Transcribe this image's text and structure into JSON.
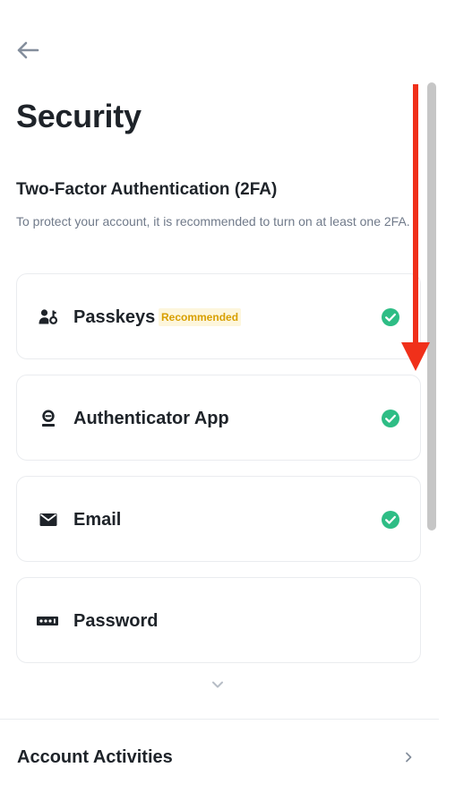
{
  "header": {
    "back_icon": "arrow-left-icon",
    "title": "Security"
  },
  "two_fa": {
    "title": "Two-Factor Authentication (2FA)",
    "description": "To protect your account, it is recommended to turn on at least one 2FA.",
    "methods": [
      {
        "label": "Passkeys",
        "icon": "passkey-icon",
        "badge": "Recommended",
        "enabled": true
      },
      {
        "label": "Authenticator App",
        "icon": "authenticator-icon",
        "enabled": true
      },
      {
        "label": "Email",
        "icon": "envelope-icon",
        "enabled": true
      },
      {
        "label": "Password",
        "icon": "password-icon",
        "enabled": false
      }
    ],
    "more_icon": "chevron-down-icon"
  },
  "activities": {
    "label": "Account Activities",
    "chevron_icon": "chevron-right-icon"
  },
  "colors": {
    "text_primary": "#1e2329",
    "text_secondary": "#707a8a",
    "check_green": "#2ebd85",
    "badge_text": "#d89f00",
    "badge_bg": "#fdf6dc",
    "annotation_red": "#f0301a",
    "scrollbar": "#c6c6c6"
  },
  "annotation": {
    "type": "scroll-direction-arrow",
    "direction": "down"
  }
}
